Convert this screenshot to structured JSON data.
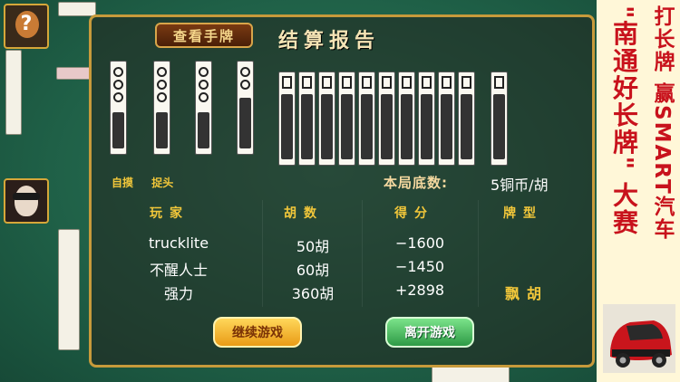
{
  "dialog": {
    "view_hand_label": "查看手牌",
    "title": "结算报告",
    "win_types": [
      "自摸",
      "捉头"
    ],
    "base_label": "本局底数:",
    "base_value": "5铜币/胡",
    "headers": {
      "player": "玩家",
      "hu": "胡数",
      "score": "得分",
      "type": "牌型"
    },
    "rows": [
      {
        "player": "trucklite",
        "hu": "50胡",
        "score": "−1600",
        "type": ""
      },
      {
        "player": "不醒人士",
        "hu": "60胡",
        "score": "−1450",
        "type": ""
      },
      {
        "player": "强力",
        "hu": "360胡",
        "score": "+2898",
        "type": "飘胡"
      }
    ],
    "continue_label": "继续游戏",
    "leave_label": "离开游戏"
  },
  "ad": {
    "line1": "打长牌 赢SMART汽车",
    "line2": "\"南通好长牌\" 大赛"
  },
  "icons": {
    "player_top_avatar": "question-avatar-icon",
    "player_left_avatar": "masked-face-avatar-icon",
    "ad_car": "smart-car-icon"
  },
  "colors": {
    "accent_gold": "#f2c73a",
    "table_green": "#1f6047",
    "ad_red": "#c8121c"
  }
}
